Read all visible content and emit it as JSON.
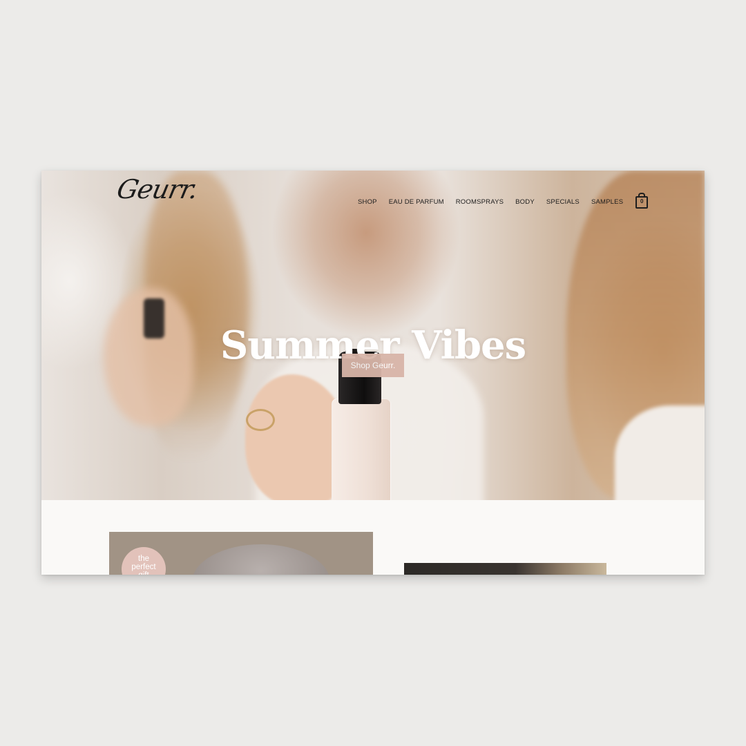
{
  "brand": {
    "logo_text": "Geurr."
  },
  "nav": {
    "items": [
      "SHOP",
      "EAU DE PARFUM",
      "ROOMSPRAYS",
      "BODY",
      "SPECIALS",
      "SAMPLES"
    ],
    "cart_count": "0"
  },
  "hero": {
    "title": "Summer Vibes",
    "button_label": "Shop Geurr.",
    "button_color": "#d8b5a8"
  },
  "promo": {
    "badge_lines": [
      "the",
      "perfect",
      "gift"
    ],
    "badge_color": "#e2c2ba"
  },
  "icons": {
    "cart": "shopping-bag-icon"
  }
}
